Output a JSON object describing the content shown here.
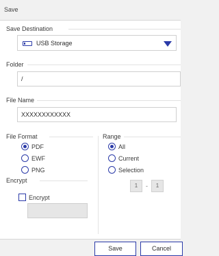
{
  "window": {
    "title": "Save"
  },
  "save_destination": {
    "label": "Save Destination",
    "selected": "USB Storage",
    "icon": "usb-storage-icon"
  },
  "folder": {
    "label": "Folder",
    "value": "/"
  },
  "file_name": {
    "label": "File Name",
    "value": "XXXXXXXXXXXX"
  },
  "file_format": {
    "label": "File Format",
    "options": [
      "PDF",
      "EWF",
      "PNG"
    ],
    "selected": "PDF"
  },
  "range": {
    "label": "Range",
    "options": [
      "All",
      "Current",
      "Selection"
    ],
    "selected": "All",
    "from": "1",
    "separator": "-",
    "to": "1"
  },
  "encrypt": {
    "label": "Encrypt",
    "checkbox_label": "Encrypt",
    "checked": false
  },
  "buttons": {
    "save": "Save",
    "cancel": "Cancel"
  },
  "colors": {
    "accent": "#2a3aa8",
    "background": "#ffffff",
    "chrome": "#f1f1f1"
  }
}
